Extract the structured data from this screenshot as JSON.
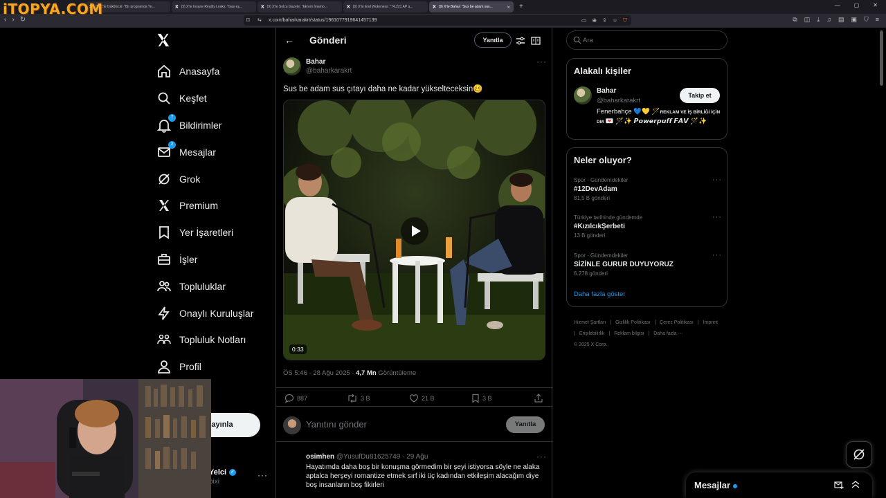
{
  "watermark": "iTOPYA.COM",
  "browser": {
    "tabs": [
      {
        "title": "(9) X'te Daktilocki: \"Bir programda \"le..."
      },
      {
        "title": "(9) X'te Insane Reality Leaks: \"Gas eş..."
      },
      {
        "title": "(9) X'te Solcu Gazete: \"Ekrem İmamo..."
      },
      {
        "title": "(9) X'te End Wokeness: \"74,221 AP a..."
      },
      {
        "title": "(9) X'te Bahar: \"Sus be adam sus..."
      }
    ],
    "url": "x.com/baharkarakrt/status/1961077919641457139"
  },
  "nav": {
    "items": [
      {
        "label": "Anasayfa",
        "icon": "home-icon"
      },
      {
        "label": "Keşfet",
        "icon": "search-icon"
      },
      {
        "label": "Bildirimler",
        "icon": "bell-icon",
        "badge": "7"
      },
      {
        "label": "Mesajlar",
        "icon": "mail-icon",
        "badge": "2"
      },
      {
        "label": "Grok",
        "icon": "grok-icon"
      },
      {
        "label": "Premium",
        "icon": "x-icon"
      },
      {
        "label": "Yer İşaretleri",
        "icon": "bookmark-icon"
      },
      {
        "label": "İşler",
        "icon": "briefcase-icon"
      },
      {
        "label": "Topluluklar",
        "icon": "people-icon"
      },
      {
        "label": "Onaylı Kuruluşlar",
        "icon": "lightning-icon"
      },
      {
        "label": "Topluluk Notları",
        "icon": "notes-icon"
      },
      {
        "label": "Profil",
        "icon": "user-icon"
      },
      {
        "label": "zla",
        "icon": "more-icon"
      }
    ],
    "post_button": "ayınla",
    "account": {
      "name": "Yelci",
      "handle": "bixi"
    }
  },
  "main": {
    "title": "Gönderi",
    "reply_button": "Yanıtla",
    "post": {
      "author_name": "Bahar",
      "author_handle": "@baharkarakrt",
      "text": "Sus be adam sus çıtayı daha ne kadar yükselteceksin🥴",
      "video_duration": "0:33",
      "time": "ÖS 5:46 · 28 Ağu 2025 · ",
      "views": "4,7 Mn",
      "views_label": " Görüntüleme",
      "replies": "887",
      "reposts": "3 B",
      "likes": "21 B",
      "bookmarks": "3 B"
    },
    "reply_placeholder": "Yanıtını gönder",
    "reply_submit": "Yanıtla",
    "comment": {
      "name": "osimhen",
      "handle": "@YusufDu81625749 · 29 Ağu",
      "text": "Hayatımda daha boş bir konuşma görmedim bir şeyi istiyorsa söyle ne alaka aptalca herşeyi romantize etmek  sırf iki üç kadından etkileşim alacağım diye boş insanların boş fikirleri"
    }
  },
  "right": {
    "search_placeholder": "Ara",
    "related_title": "Alakalı kişiler",
    "related": {
      "name": "Bahar",
      "handle": "@baharkarakrt",
      "follow": "Takip et",
      "bio_main": "Fenerbahçe 💙💛 🪄",
      "bio_small": "REKLAM VE İŞ BİRLİĞİ İÇİN DM",
      "bio_tail": " 💌 🪄✨ 𝙋𝙤𝙬𝙚𝙧𝙥𝙪𝙛𝙛 𝙁𝘼𝙑 🪄✨"
    },
    "trends_title": "Neler oluyor?",
    "trends": [
      {
        "category": "Spor · Gündemdekiler",
        "name": "#12DevAdam",
        "count": "81,5 B gönderi"
      },
      {
        "category": "Türkiye tarihinde gündemde",
        "name": "#KızılcıkŞerbeti",
        "count": "13 B gönderi"
      },
      {
        "category": "Spor · Gündemdekiler",
        "name": "SİZİNLE GURUR DUYUYORUZ",
        "count": "6.278 gönderi"
      }
    ],
    "show_more": "Daha fazla göster",
    "footer": [
      "Hizmet Şartları",
      "|",
      "Gizlilik Politikası",
      "|",
      "Çerez Politikası",
      "|",
      "Imprint",
      "|",
      "Erişilebilirlik",
      "|",
      "Reklam bilgisi",
      "|",
      "Daha fazla ···",
      "© 2025 X Corp."
    ]
  },
  "messages_drawer": {
    "title": "Mesajlar"
  }
}
